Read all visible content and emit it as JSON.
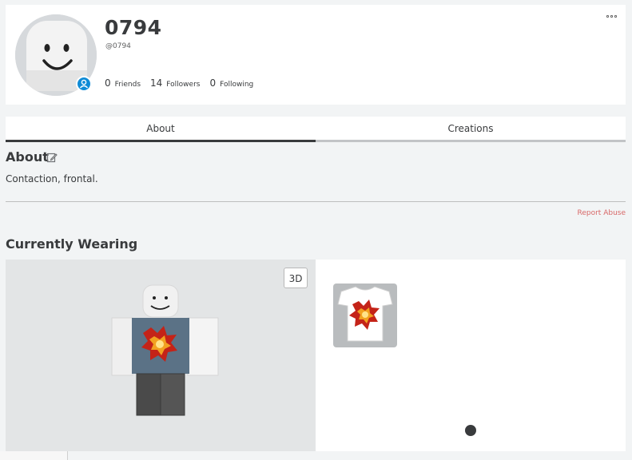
{
  "profile": {
    "display_name": "0794",
    "handle": "@0794",
    "stats": [
      {
        "count": "0",
        "label": "Friends"
      },
      {
        "count": "14",
        "label": "Followers"
      },
      {
        "count": "0",
        "label": "Following"
      }
    ]
  },
  "tabs": [
    {
      "label": "About",
      "active": true
    },
    {
      "label": "Creations",
      "active": false
    }
  ],
  "about": {
    "title": "About",
    "text": "Contaction, frontal.",
    "report_label": "Report Abuse"
  },
  "wearing": {
    "title": "Currently Wearing",
    "viewer_button": "3D",
    "items": [
      {
        "icon": "explosion-tshirt-icon"
      }
    ]
  },
  "colors": {
    "online_badge": "#0f8bd6",
    "report_link": "#d86868",
    "shirt": "#5b7286"
  }
}
